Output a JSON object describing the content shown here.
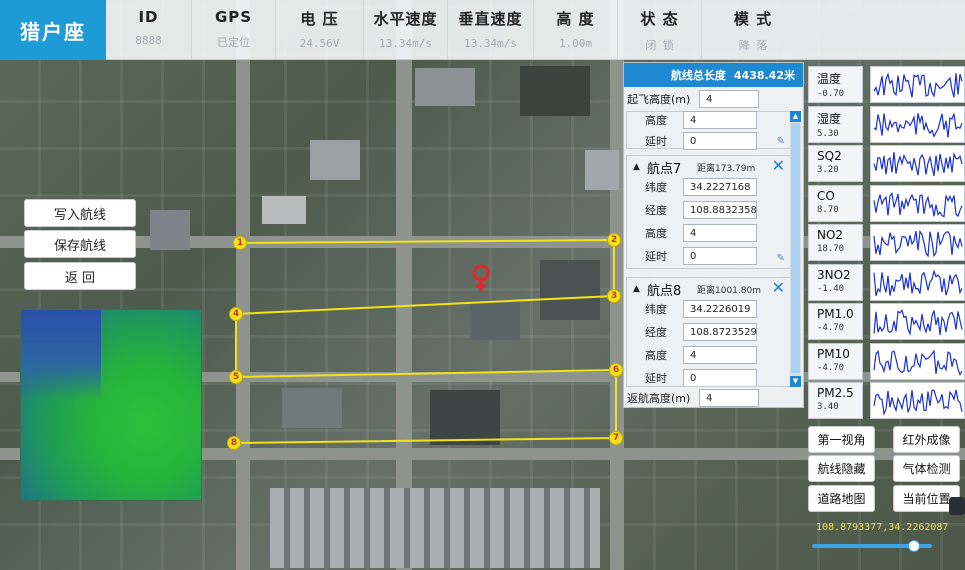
{
  "app": {
    "title": "猎户座"
  },
  "header": {
    "stats": [
      {
        "label": "ID",
        "value": "8888"
      },
      {
        "label": "GPS",
        "value": "已定位"
      },
      {
        "label": "电  压",
        "value": "24.56V"
      },
      {
        "label": "水平速度",
        "value": "13.34m/s"
      },
      {
        "label": "垂直速度",
        "value": "13.34m/s"
      },
      {
        "label": "高  度",
        "value": "1.00m"
      },
      {
        "label": "状  态",
        "value": "闭 锁"
      },
      {
        "label": "模  式",
        "value": "降 落"
      }
    ]
  },
  "left_buttons": {
    "write_route": "写入航线",
    "save_route": "保存航线",
    "back": "返  回"
  },
  "waypoint_markers": [
    "1",
    "2",
    "3",
    "4",
    "5",
    "6",
    "7",
    "8"
  ],
  "route_panel": {
    "total_length_label": "航线总长度",
    "total_length_value": "4438.42米",
    "takeoff_height_label": "起飞高度(m)",
    "takeoff_height_value": "4",
    "partial": {
      "height_label": "高度",
      "height_value": "4",
      "delay_label": "延时",
      "delay_value": "0"
    },
    "waypoints": [
      {
        "title": "航点7",
        "distance": "距离173.79m",
        "lat_label": "纬度",
        "lat": "34.2227168",
        "lng_label": "经度",
        "lng": "108.8832358",
        "height_label": "高度",
        "height": "4",
        "delay_label": "延时",
        "delay": "0"
      },
      {
        "title": "航点8",
        "distance": "距离1001.80m",
        "lat_label": "纬度",
        "lat": "34.2226019",
        "lng_label": "经度",
        "lng": "108.8723529",
        "height_label": "高度",
        "height": "4",
        "delay_label": "延时",
        "delay": "0"
      }
    ],
    "return_height_label": "返航高度(m)",
    "return_height_value": "4"
  },
  "sensors": [
    {
      "name": "温度",
      "value": "-0.70"
    },
    {
      "name": "湿度",
      "value": "5.30"
    },
    {
      "name": "SQ2",
      "value": "3.20"
    },
    {
      "name": "CO",
      "value": "8.70"
    },
    {
      "name": "NO2",
      "value": "18.70"
    },
    {
      "name": "3NO2",
      "value": "-1.40"
    },
    {
      "name": "PM1.0",
      "value": "-4.70"
    },
    {
      "name": "PM10",
      "value": "-4.70"
    },
    {
      "name": "PM2.5",
      "value": "3.40"
    }
  ],
  "right_buttons": {
    "first_person": "第一视角",
    "infrared": "红外成像",
    "hide_route": "航线隐藏",
    "gas_detect": "气体检测",
    "road_map": "道路地图",
    "current_position": "当前位置"
  },
  "coordinates": "108.8793377,34.2262087",
  "zoom_slider": {
    "level": 0.85
  },
  "colors": {
    "accent": "#1e9ad6",
    "route_line": "#f2e21a",
    "location_pin": "#e3262a",
    "sensor_line": "#1a2fd8"
  }
}
